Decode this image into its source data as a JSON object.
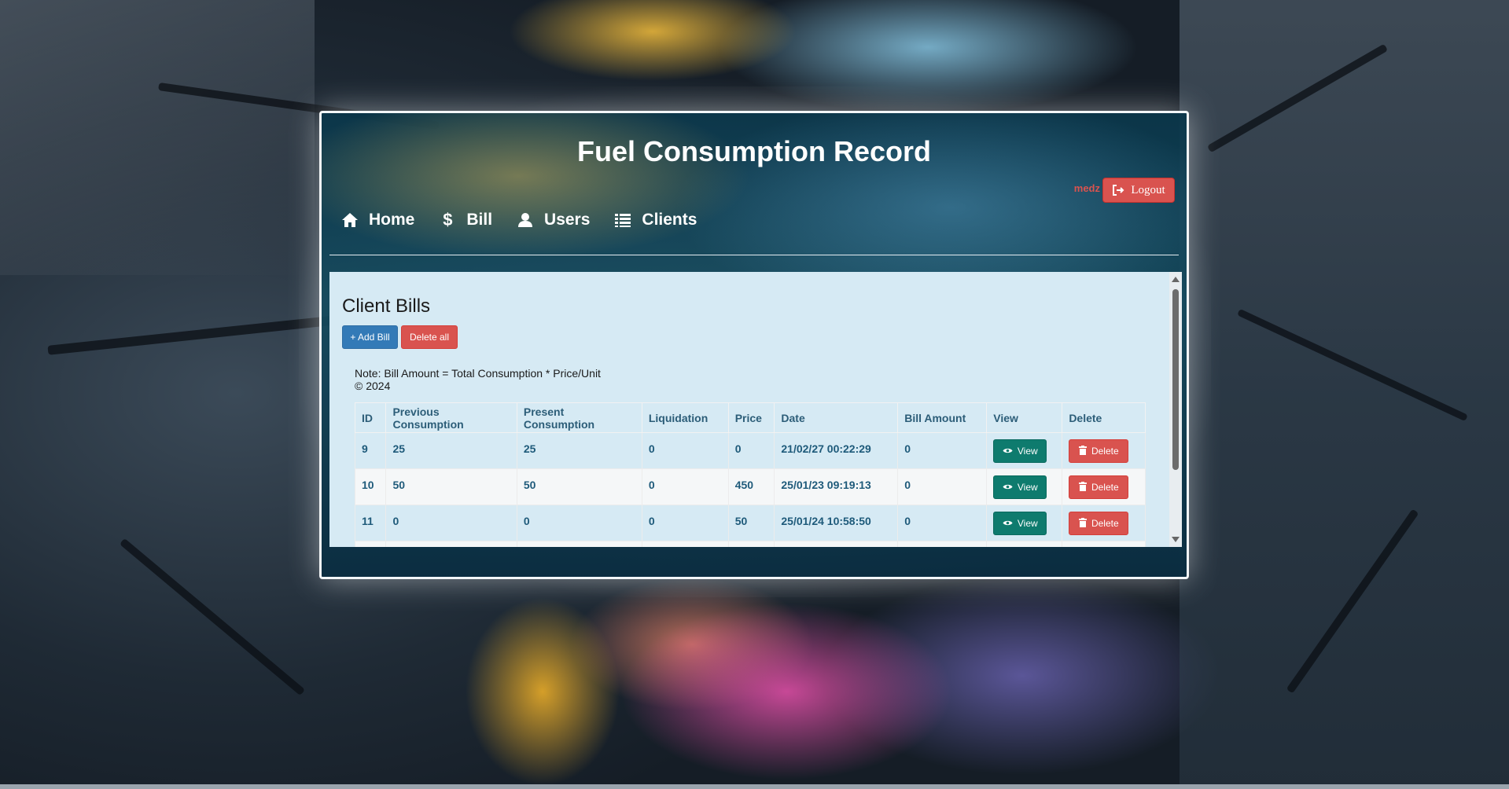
{
  "header": {
    "title": "Fuel Consumption Record",
    "username": "medz",
    "logout_label": "Logout"
  },
  "nav": {
    "items": [
      {
        "label": "Home",
        "icon": "home-icon"
      },
      {
        "label": "Bill",
        "icon": "dollar-icon"
      },
      {
        "label": "Users",
        "icon": "user-icon"
      },
      {
        "label": "Clients",
        "icon": "list-icon"
      }
    ]
  },
  "main": {
    "section_title": "Client Bills",
    "add_bill_label": "+ Add Bill",
    "delete_all_label": "Delete all",
    "note": "Note: Bill Amount = Total Consumption * Price/Unit",
    "copyright": "© 2024"
  },
  "table": {
    "headers": [
      "ID",
      "Previous Consumption",
      "Present Consumption",
      "Liquidation",
      "Price",
      "Date",
      "Bill Amount",
      "View",
      "Delete"
    ],
    "view_label": "View",
    "delete_label": "Delete",
    "rows": [
      {
        "id": "9",
        "previous": "25",
        "present": "25",
        "liquidation": "0",
        "price": "0",
        "date": "21/02/27 00:22:29",
        "amount": "0"
      },
      {
        "id": "10",
        "previous": "50",
        "present": "50",
        "liquidation": "0",
        "price": "450",
        "date": "25/01/23 09:19:13",
        "amount": "0"
      },
      {
        "id": "11",
        "previous": "0",
        "present": "0",
        "liquidation": "0",
        "price": "50",
        "date": "25/01/24 10:58:50",
        "amount": "0"
      }
    ]
  },
  "colors": {
    "primary": "#337ab7",
    "danger": "#d9534f",
    "view": "#0e7b6e",
    "content_bg": "#d6eaf4"
  }
}
